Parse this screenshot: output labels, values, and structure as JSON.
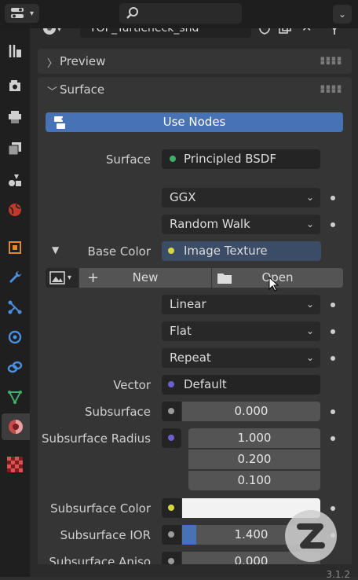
{
  "material": {
    "name": "TOP_Turtleneck_shd"
  },
  "panels": {
    "preview": {
      "title": "Preview"
    },
    "surface": {
      "title": "Surface"
    }
  },
  "use_nodes_label": "Use Nodes",
  "surface_row": {
    "label": "Surface",
    "value": "Principled BSDF"
  },
  "distribution": "GGX",
  "subsurface_method": "Random Walk",
  "base_color": {
    "label": "Base Color",
    "value": "Image Texture"
  },
  "image_buttons": {
    "new": "New",
    "open": "Open"
  },
  "interpolation": "Linear",
  "projection": "Flat",
  "extension": "Repeat",
  "vector": {
    "label": "Vector",
    "value": "Default"
  },
  "subsurface": {
    "label": "Subsurface",
    "value": "0.000"
  },
  "subsurface_radius": {
    "label": "Subsurface Radius",
    "values": [
      "1.000",
      "0.200",
      "0.100"
    ]
  },
  "subsurface_color": {
    "label": "Subsurface Color",
    "color": "#f2f2f2"
  },
  "subsurface_ior": {
    "label": "Subsurface IOR",
    "value": "1.400",
    "fill": 0.1
  },
  "subsurface_aniso": {
    "label": "Subsurface Aniso",
    "value": "0.000"
  },
  "version": "3.1.2",
  "colors": {
    "accent": "#4772b3",
    "shader_socket": "#3fb06a",
    "color_socket": "#d6d640",
    "vector_socket": "#6b5fd1",
    "float_socket": "#9a9a9a"
  },
  "sidebar_icons": [
    "tool-icon",
    "render-icon",
    "output-icon",
    "view-layer-icon",
    "scene-icon",
    "world-icon",
    "object-icon",
    "modifier-icon",
    "particles-icon",
    "physics-icon",
    "constraints-icon",
    "data-icon",
    "material-icon",
    "texture-icon"
  ]
}
